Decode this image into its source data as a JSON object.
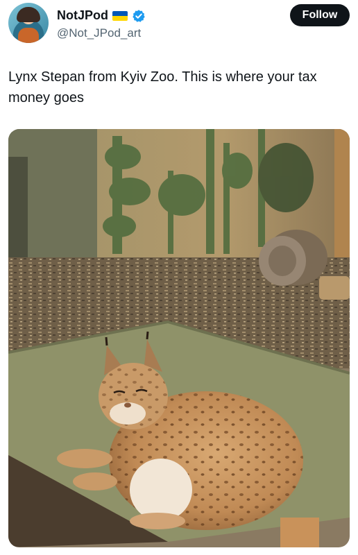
{
  "tweet": {
    "display_name": "NotJPod",
    "handle": "@Not_JPod_art",
    "follow_label": "Follow",
    "text": "Lynx Stepan from Kyiv Zoo. This is where your tax money goes",
    "media_description": "photo"
  },
  "icons": {
    "flag": "ukraine-flag-icon",
    "verified": "verified-badge-icon"
  },
  "colors": {
    "text_primary": "#0f1419",
    "text_secondary": "#536471",
    "verified_blue": "#1d9bf0",
    "follow_bg": "#0f1419"
  }
}
